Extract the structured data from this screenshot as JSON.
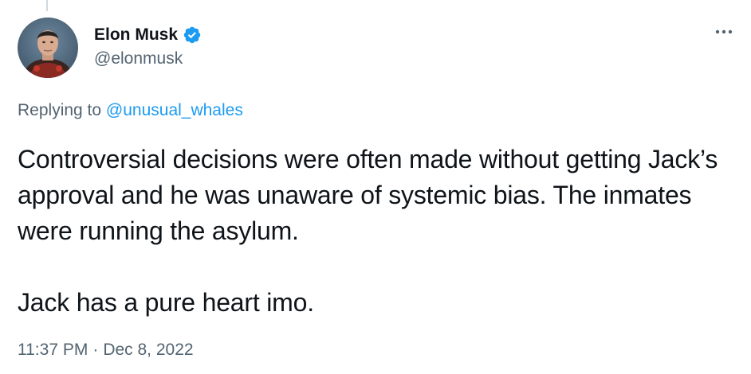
{
  "author": {
    "display_name": "Elon Musk",
    "handle": "@elonmusk",
    "verified": true,
    "avatar_icon": "profile-photo"
  },
  "reply": {
    "prefix": "Replying to ",
    "mention": "@unusual_whales"
  },
  "tweet": {
    "paragraph_1": "Controversial decisions were often made without getting Jack’s approval and he was unaware of systemic bias. The inmates were running the asylum.",
    "paragraph_2": "Jack has a pure heart imo."
  },
  "meta": {
    "time": "11:37 PM",
    "separator": "·",
    "date": "Dec 8, 2022"
  },
  "icons": {
    "verified": "verified-badge-icon",
    "more": "more-options-icon"
  },
  "colors": {
    "text": "#0f1419",
    "secondary": "#536471",
    "accent": "#1d9bf0",
    "background": "#ffffff"
  }
}
